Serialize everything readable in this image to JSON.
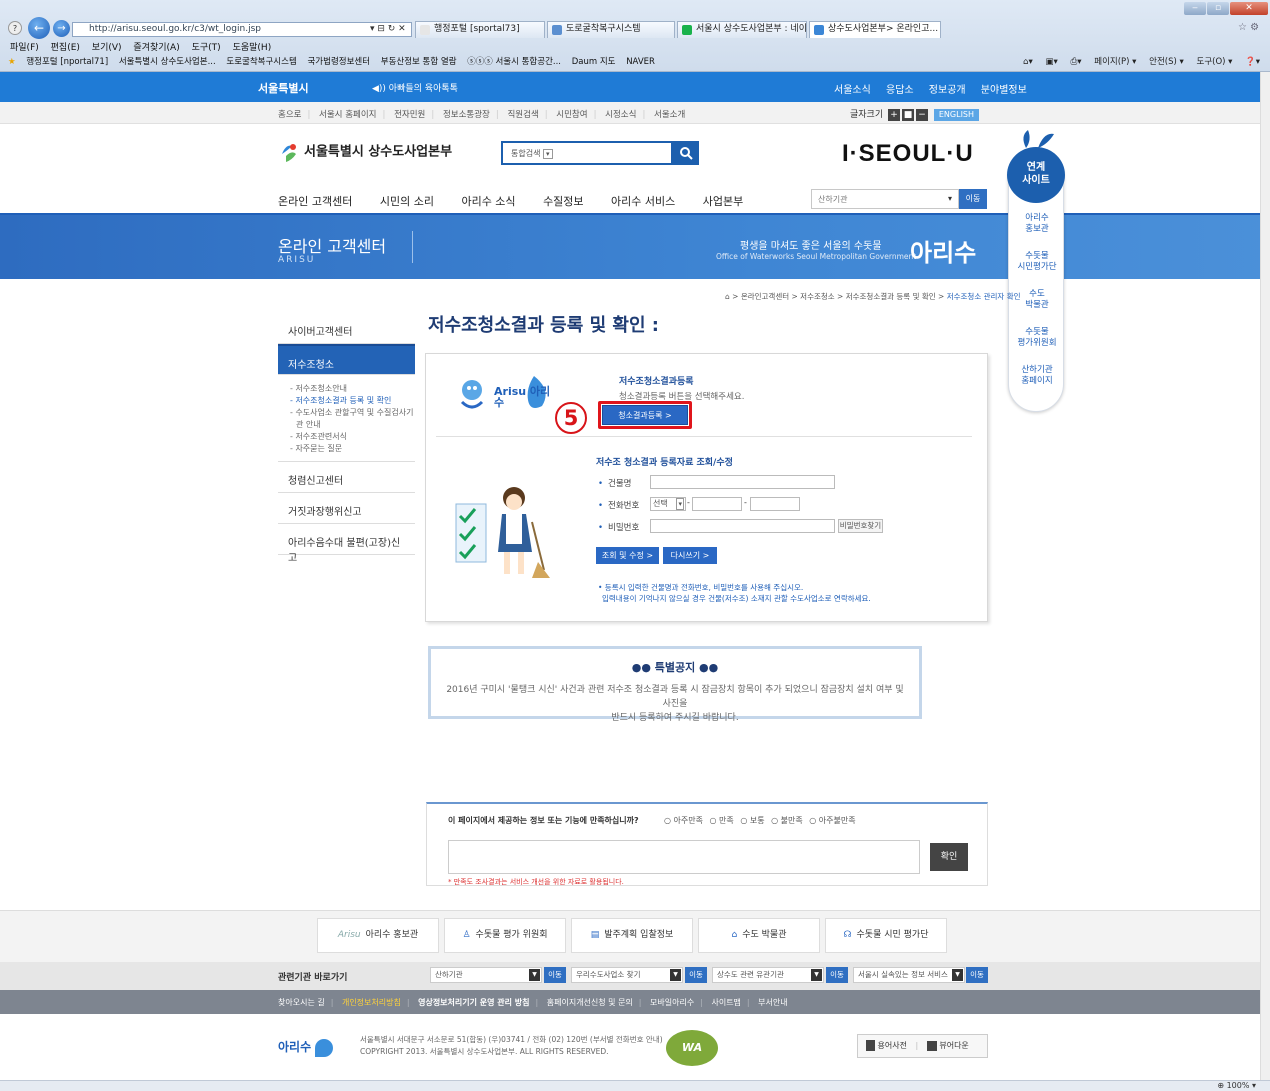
{
  "browser": {
    "address": "http://arisu.seoul.go.kr/c3/wt_login.jsp",
    "tabs": [
      "행정포털 [sportal73]",
      "도로굴착복구시스템",
      "서울시 상수도사업본부 : 네이...",
      "상수도사업본부> 온라인고...  ×"
    ],
    "menu": [
      "파일(F)",
      "편집(E)",
      "보기(V)",
      "즐겨찾기(A)",
      "도구(T)",
      "도움말(H)"
    ],
    "favorites": [
      "행정포털 [nportal71]",
      "서울특별시 상수도사업본...",
      "도로굴착복구시스템",
      "국가법령정보센터",
      "부동산정보 통합 열람",
      "ⓢⓢⓢ 서울시 통합공간...",
      "Daum 지도",
      "NAVER"
    ],
    "commands": [
      "페이지(P) ▾",
      "안전(S) ▾",
      "도구(O) ▾"
    ],
    "zoom": "100%"
  },
  "site": {
    "top_logo": "서울특별시",
    "top_slogan": "◀)) 아빠들의 육아톡톡",
    "top_links": [
      "서울소식",
      "응답소",
      "정보공개",
      "분야별정보"
    ],
    "util_links": [
      "홈으로",
      "서울시 홈페이지",
      "전자민원",
      "정보소통광장",
      "직원검색",
      "시민참여",
      "시정소식",
      "서울소개"
    ],
    "font_size_label": "글자크기",
    "english_label": "ENGLISH",
    "brand": "서울특별시 상수도사업본부",
    "search_select": "통합검색",
    "iseoulu": "I·SEOUL·U",
    "gnb": [
      "온라인 고객센터",
      "시민의 소리",
      "아리수 소식",
      "수질정보",
      "아리수 서비스",
      "사업본부"
    ],
    "org_select": "산하기관",
    "org_go": "이동"
  },
  "banner": {
    "title": "온라인 고객센터",
    "subtitle": "ARISU",
    "slogan1": "평생을 마셔도 좋은 서울의 수돗물",
    "slogan2": "Office of Waterworks Seoul Metropolitan Government",
    "brand": "아리수"
  },
  "quick": {
    "head": "연계\n사이트",
    "items": [
      "아리수\n홍보관",
      "수돗물\n시민평가단",
      "수도\n박물관",
      "수돗물\n평가위원회",
      "산하기관\n홈페이지"
    ]
  },
  "breadcrumb": "⌂ > 온라인고객센터 > 저수조청소 > 저수조청소결과 등록 및 확인 > ",
  "breadcrumb_last": "저수조청소 관리자 확인",
  "page_title": "저수조청소결과 등록 및 확인 :",
  "lnb": {
    "items_top": [
      "사이버고객센터"
    ],
    "active": "저수조청소",
    "sub": [
      "저수조청소안내",
      "저수조청소결과 등록 및 확인",
      "수도사업소 관할구역 및 수질검사기관 안내",
      "저수조관련서식",
      "자주묻는 질문"
    ],
    "items_bottom": [
      "청렴신고센터",
      "거짓과장행위신고",
      "아리수음수대 불편(고장)신고"
    ]
  },
  "reg": {
    "arisu_logo": "Arisu 아리수",
    "title": "저수조청소결과등록",
    "desc": "청소결과등록 버튼을 선택해주세요.",
    "button": "청소결과등록  >",
    "annotation": "5"
  },
  "lookup": {
    "title": "저수조 청소결과 등록자료 조회/수정",
    "building_label": "건물명",
    "phone_label": "전화번호",
    "phone_select": "선택",
    "password_label": "비밀번호",
    "find_password": "비밀번호찾기",
    "search_button": "조회 및 수정  >",
    "reset_button": "다시쓰기  >",
    "note1": "• 등록시 입력한 건물명과 전화번호, 비밀번호를 사용해 주십시오.",
    "note2": "입력내용이 기억나지 않으실 경우 건물(저수조) 소재지 관할 수도사업소로 연락하세요."
  },
  "notice": {
    "title": "●● 특별공지 ●●",
    "body1": "2016년 구미시 '물탱크 시신' 사건과 관련 저수조 청소결과 등록 시 잠금장치 항목이 추가 되었으니 잠금장치 설치 여부 및 사진을",
    "body2": "반드시 등록하여 주시길 바랍니다."
  },
  "survey": {
    "question": "이 페이지에서 제공하는 정보 또는 기능에 만족하십니까?",
    "options": [
      "○ 아주만족",
      "○ 만족",
      "○ 보통",
      "○ 불만족",
      "○ 아주불만족"
    ],
    "submit": "확인",
    "note": "* 만족도 조사결과는 서비스 개선을 위한 자료로 활용됩니다."
  },
  "footer": {
    "banners": [
      "아리수 홍보관",
      "수돗물 평가 위원회",
      "발주계획 입찰정보",
      "수도 박물관",
      "수돗물 시민 평가단"
    ],
    "banner_prefix": "Arisu",
    "related_label": "관련기관 바로가기",
    "selects": [
      "산하기관",
      "우리수도사업소 찾기",
      "상수도 관련 유관기관",
      "서울시 실속있는 정보 서비스"
    ],
    "go": "이동",
    "links": [
      "찾아오시는 길",
      "개인정보처리방침",
      "영상정보처리기기 운영 관리 방침",
      "홈페이지개선신청 및 문의",
      "모바일아리수",
      "사이트맵",
      "부서안내"
    ],
    "logo": "아리수",
    "addr1": "서울특별시 서대문구 서소문로 51(합동) (우)03741 / 전화 (02) 120번 (부서별 전화번호 안내)",
    "addr2": "COPYRIGHT 2013. 서울특별시 상수도사업본부. ALL RIGHTS RESERVED.",
    "wa": "WA",
    "dict1": "용어사전",
    "dict2": "뷰어다운"
  },
  "colors": {
    "brand_blue": "#1f7bd6",
    "nav_blue": "#2363b6",
    "annotation_red": "#e0151b"
  }
}
